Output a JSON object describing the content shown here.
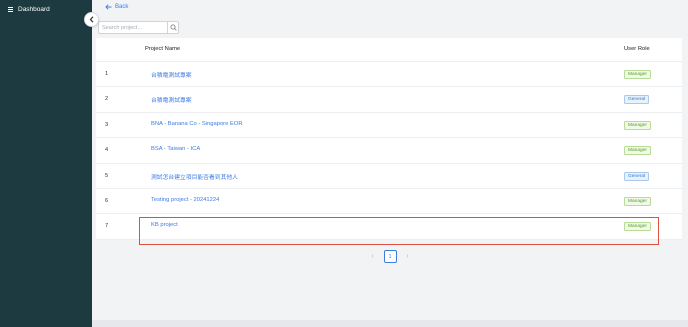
{
  "sidebar": {
    "menu_label": "Dashboard"
  },
  "header": {
    "back_label": "Back"
  },
  "search": {
    "placeholder": "Search project..."
  },
  "table": {
    "columns": {
      "name": "Project Name",
      "role": "User Role"
    },
    "rows": [
      {
        "num": "1",
        "name": "台積電測試專案",
        "role": "Manager",
        "role_type": "manager"
      },
      {
        "num": "2",
        "name": "台積電測試專案",
        "role": "General",
        "role_type": "general"
      },
      {
        "num": "3",
        "name": "BNA - Banana Co - Singapore EOR",
        "role": "Manager",
        "role_type": "manager"
      },
      {
        "num": "4",
        "name": "BSA - Taiwan - ICA",
        "role": "Manager",
        "role_type": "manager"
      },
      {
        "num": "5",
        "name": "測試怎台建立項目能否看到其他人",
        "role": "General",
        "role_type": "general"
      },
      {
        "num": "6",
        "name": "Testing project - 20241224",
        "role": "Manager",
        "role_type": "manager"
      },
      {
        "num": "7",
        "name": "KB project",
        "role": "Manager",
        "role_type": "manager"
      }
    ]
  },
  "pagination": {
    "current_page": "1"
  },
  "colors": {
    "sidebar_bg": "#1d3a41",
    "link": "#3d7de0",
    "manager_badge": "#5d9b2c",
    "general_badge": "#3a77cf",
    "highlight": "#e05040"
  },
  "icons": [
    "hamburger-icon",
    "chevron-left-icon",
    "arrow-left-icon",
    "search-icon"
  ]
}
